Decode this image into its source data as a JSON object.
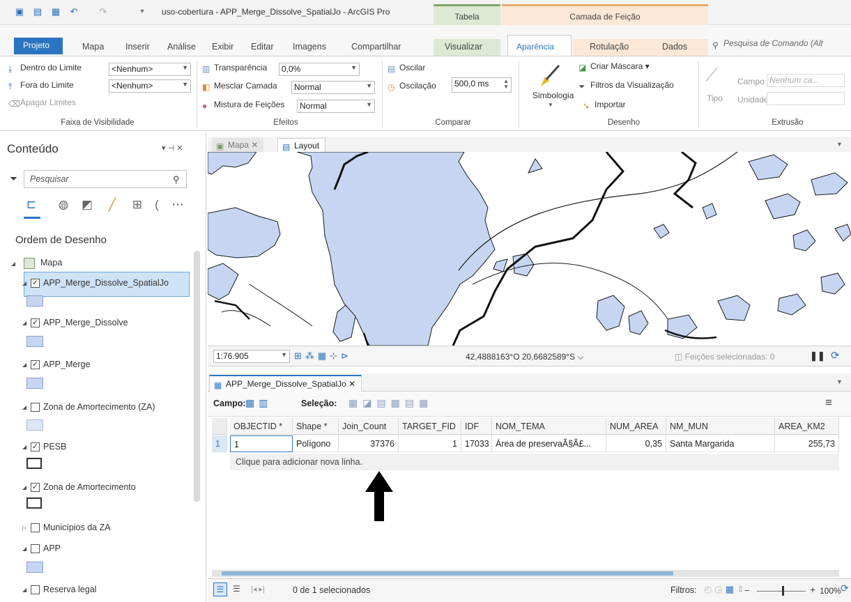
{
  "window": {
    "title": "uso-cobertura - APP_Merge_Dissolve_SpatialJo - ArcGIS Pro",
    "context_tab_tabela": "Tabela",
    "context_tab_camada": "Camada de Feição"
  },
  "ribbon_tabs": [
    "Projeto",
    "Mapa",
    "Inserir",
    "Análise",
    "Exibir",
    "Editar",
    "Imagens",
    "Compartilhar",
    "Visualizar",
    "Aparência",
    "Rotulação",
    "Dados"
  ],
  "command_search": {
    "placeholder": "Pesquisa de Comando (Alt"
  },
  "ribbon": {
    "visibility": {
      "in_limit": "Dentro do Limite",
      "out_limit": "Fora do Limite",
      "clear_limits": "Apagar Limites",
      "in_value": "<Nenhum>",
      "out_value": "<Nenhum>",
      "group_label": "Faixa de Visibilidade"
    },
    "effects": {
      "transparency": "Transparência",
      "transparency_value": "0,0%",
      "blend_layer": "Mesclar Camada",
      "blend_value": "Normal",
      "feature_blend": "Mistura de Feições",
      "feature_blend_value": "Normal",
      "group_label": "Efeitos"
    },
    "compare": {
      "swipe": "Oscilar",
      "flicker": "Oscilação",
      "flicker_value": "500,0 ms",
      "group_label": "Comparar"
    },
    "drawing": {
      "symbology": "Simbologia",
      "create_mask": "Criar Máscara",
      "view_filters": "Filtros da Visualização",
      "import": "Importar",
      "group_label": "Desenho"
    },
    "extrusion": {
      "type": "Tipo",
      "field": "Campo",
      "field_value": "Nenhum ca...",
      "unit": "Unidade",
      "group_label": "Extrusão"
    }
  },
  "contents": {
    "title": "Conteúdo",
    "search_placeholder": "Pesquisar",
    "drawing_order": "Ordem de Desenho",
    "map_name": "Mapa",
    "layers": [
      {
        "name": "APP_Merge_Dissolve_SpatialJo",
        "checked": true,
        "swatch": "fill"
      },
      {
        "name": "APP_Merge_Dissolve",
        "checked": true,
        "swatch": "fill"
      },
      {
        "name": "APP_Merge",
        "checked": true,
        "swatch": "fill"
      },
      {
        "name": "Zona de Amortecimento (ZA)",
        "checked": false,
        "swatch": "pale"
      },
      {
        "name": "PESB",
        "checked": true,
        "swatch": "outline"
      },
      {
        "name": "Zona de Amortecimento",
        "checked": true,
        "swatch": "outline"
      },
      {
        "name": "Municípios da ZA",
        "checked": false,
        "swatch": "none"
      },
      {
        "name": "APP",
        "checked": false,
        "swatch": "fill"
      },
      {
        "name": "Reserva legal",
        "checked": false,
        "swatch": "none"
      }
    ]
  },
  "map": {
    "tabs": [
      "Mapa",
      "Layout"
    ],
    "scale": "1:76.905",
    "coordinates": "42,4888163°O 20,6682589°S",
    "selected_features": "Feições selecionadas: 0",
    "colors": {
      "water": "#c6d6f2",
      "outline": "#1a1a1a"
    }
  },
  "table": {
    "tab_title": "APP_Merge_Dissolve_SpatialJo",
    "field_label": "Campo:",
    "selection_label": "Seleção:",
    "columns": [
      "OBJECTID *",
      "Shape *",
      "Join_Count",
      "TARGET_FID",
      "IDF",
      "NOM_TEMA",
      "NUM_AREA",
      "NM_MUN",
      "AREA_KM2"
    ],
    "rows": [
      {
        "index": "1",
        "cells": [
          "1",
          "Polígono",
          "37376",
          "1",
          "17033",
          "Área de preservaÃ§Ã£...",
          "0,35",
          "Santa Margarida",
          "255,73"
        ]
      }
    ],
    "add_row": "Clique para adicionar nova linha.",
    "selected_count": "0 de 1 selecionados",
    "filters_label": "Filtros:",
    "zoom": "100%"
  }
}
